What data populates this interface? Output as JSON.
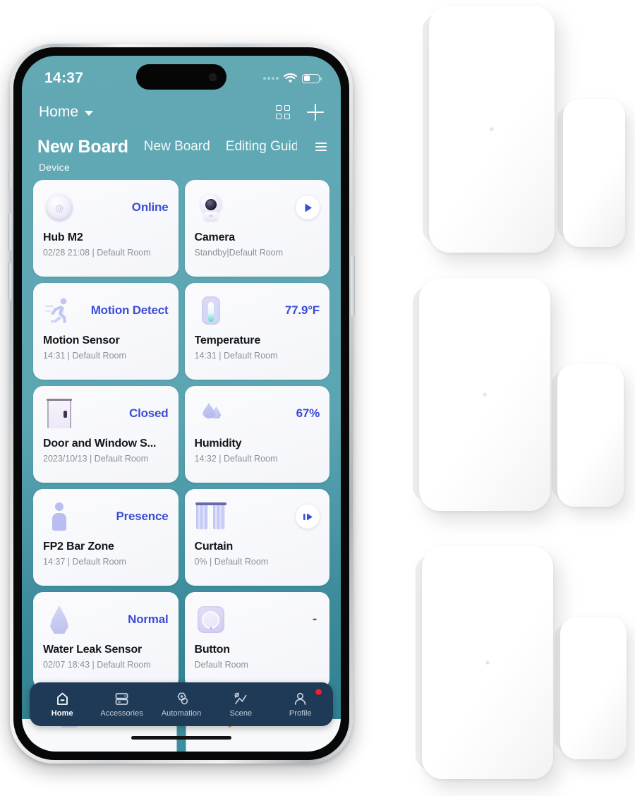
{
  "phone": {
    "status_bar": {
      "time": "14:37",
      "signal_icon": "cellular-signal-icon",
      "wifi_icon": "wifi-icon",
      "battery_icon": "battery-icon"
    },
    "app_header": {
      "home_label": "Home",
      "caret_icon": "chevron-down-icon",
      "grid_icon": "grid-view-icon",
      "add_icon": "plus-icon"
    },
    "board_tabs": {
      "active_tab": "New Board",
      "tabs": [
        "New Board",
        "New Board",
        "Editing Guide"
      ],
      "secondary_tab": "New Board",
      "third_tab": "Editing Guida",
      "menu_icon": "hamburger-menu-icon"
    },
    "section_label": "Device",
    "cards": [
      {
        "icon": "hub-icon",
        "value": "Online",
        "title": "Hub M2",
        "subtitle": "02/28 21:08 | Default Room"
      },
      {
        "icon": "camera-icon",
        "value": "",
        "action_icon": "play-icon",
        "title": "Camera",
        "subtitle": "Standby|Default Room"
      },
      {
        "icon": "motion-sensor-icon",
        "value": "Motion Detect",
        "title": "Motion Sensor",
        "subtitle": "14:31 | Default Room"
      },
      {
        "icon": "thermometer-icon",
        "value": "77.9°F",
        "title": "Temperature",
        "subtitle": "14:31 | Default Room"
      },
      {
        "icon": "door-icon",
        "value": "Closed",
        "title": "Door and Window S...",
        "subtitle": "2023/10/13 | Default Room"
      },
      {
        "icon": "humidity-drop-icon",
        "value": "67%",
        "title": "Humidity",
        "subtitle": "14:32 | Default Room"
      },
      {
        "icon": "person-icon",
        "value": "Presence",
        "title": "FP2 Bar Zone",
        "subtitle": "14:37 | Default Room"
      },
      {
        "icon": "curtain-icon",
        "value": "",
        "action_icon": "open-curtain-icon",
        "title": "Curtain",
        "subtitle": "0% | Default Room"
      },
      {
        "icon": "water-leak-icon",
        "value": "Normal",
        "title": "Water Leak Sensor",
        "subtitle": "02/07 18:43 | Default Room"
      },
      {
        "icon": "button-icon",
        "value": "-",
        "title": "Button",
        "subtitle": "Default Room"
      }
    ],
    "tab_bar": {
      "items": [
        {
          "label": "Home",
          "icon": "home-icon",
          "active": true,
          "badge": false
        },
        {
          "label": "Accessories",
          "icon": "accessories-icon",
          "active": false,
          "badge": false
        },
        {
          "label": "Automation",
          "icon": "automation-icon",
          "active": false,
          "badge": false
        },
        {
          "label": "Scene",
          "icon": "scene-icon",
          "active": false,
          "badge": false
        },
        {
          "label": "Profile",
          "icon": "profile-icon",
          "active": false,
          "badge": true
        }
      ]
    }
  },
  "products": {
    "label": "door-and-window-sensor",
    "units": [
      {
        "name": "sensor-body-1"
      },
      {
        "name": "sensor-magnet-1"
      },
      {
        "name": "sensor-body-2"
      },
      {
        "name": "sensor-magnet-2"
      },
      {
        "name": "sensor-body-3"
      },
      {
        "name": "sensor-magnet-3"
      }
    ]
  },
  "colors": {
    "screen_teal": "#5aa5b2",
    "accent_blue": "#3b4cd6",
    "tabbar_navy": "#1e3a57",
    "badge_red": "#e8232a"
  }
}
